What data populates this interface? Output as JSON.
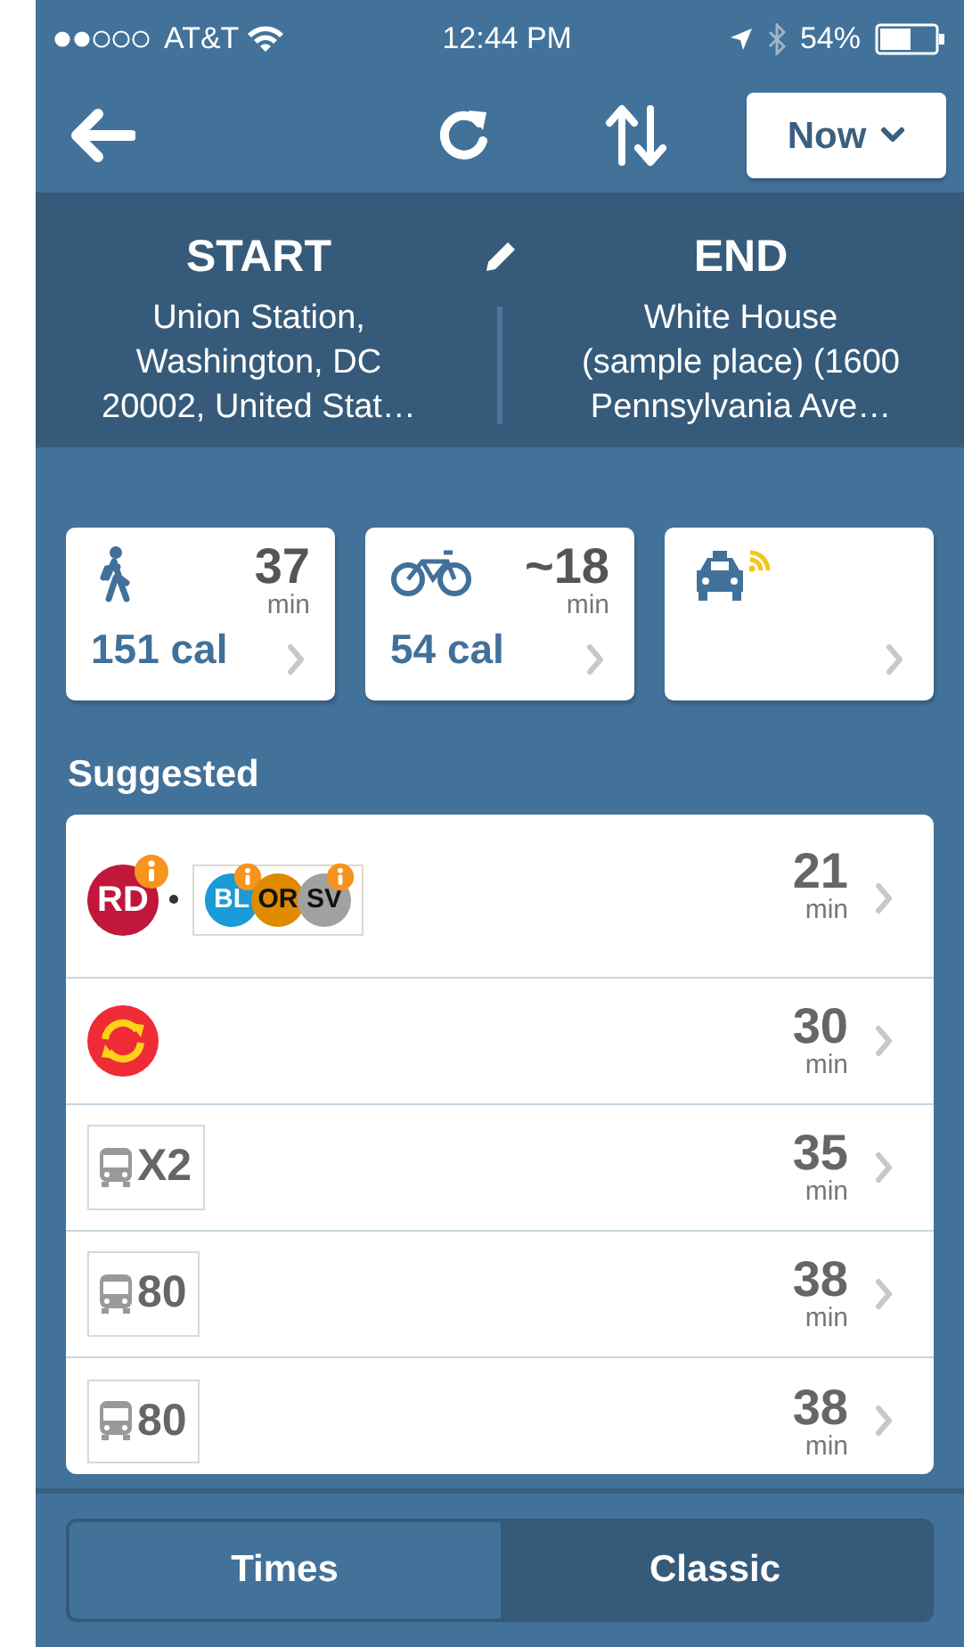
{
  "status_bar": {
    "carrier": "AT&T",
    "time": "12:44 PM",
    "battery": "54%"
  },
  "toolbar": {
    "time_button": "Now"
  },
  "trip": {
    "start": {
      "label": "START",
      "address": "Union Station,\nWashington, DC\n20002, United Stat…"
    },
    "end": {
      "label": "END",
      "address": "White House\n(sample place) (1600\nPennsylvania Ave…"
    }
  },
  "modes": [
    {
      "kind": "walk",
      "time": "37",
      "unit": "min",
      "calories": "151 cal"
    },
    {
      "kind": "bike",
      "time": "~18",
      "unit": "min",
      "calories": "54 cal"
    },
    {
      "kind": "taxi"
    }
  ],
  "suggested": {
    "title": "Suggested",
    "routes": [
      {
        "kind": "metro",
        "time": "21",
        "unit": "min",
        "groups": [
          [
            {
              "line": "RD",
              "color": "#c0173a",
              "info": true
            }
          ],
          [
            {
              "line": "BL",
              "color": "#1a9ad6",
              "info": true
            },
            {
              "line": "OR",
              "color": "#e08a00",
              "info": false
            },
            {
              "line": "SV",
              "color": "#a0a2a0",
              "info": true
            }
          ]
        ]
      },
      {
        "kind": "circulator",
        "time": "30",
        "unit": "min"
      },
      {
        "kind": "bus",
        "route": "X2",
        "time": "35",
        "unit": "min"
      },
      {
        "kind": "bus",
        "route": "80",
        "time": "38",
        "unit": "min"
      },
      {
        "kind": "bus",
        "route": "80",
        "time": "38",
        "unit": "min"
      }
    ]
  },
  "view_toggle": [
    {
      "label": "Times",
      "selected": false
    },
    {
      "label": "Classic",
      "selected": true
    }
  ]
}
